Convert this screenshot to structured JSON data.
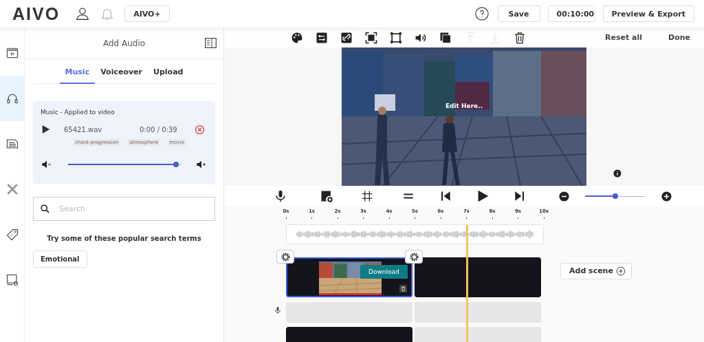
{
  "header": {
    "logo": "AIVO",
    "plan_button": "AIVO+",
    "save_button": "Save",
    "duration": "00:10:00",
    "export_button": "Preview & Export"
  },
  "rail": [
    {
      "selected": false
    },
    {
      "selected": true
    },
    {
      "selected": false
    },
    {
      "selected": false
    },
    {
      "selected": false
    },
    {
      "selected": false
    }
  ],
  "panel": {
    "title": "Add Audio",
    "tabs": [
      {
        "label": "Music",
        "selected": true
      },
      {
        "label": "Voiceover",
        "selected": false
      },
      {
        "label": "Upload",
        "selected": false
      }
    ],
    "track": {
      "heading": "Music - Applied to video",
      "file": "65421.wav",
      "time": "0:00 / 0:39",
      "tags": [
        "chord-progression",
        "atmosphere",
        "movie"
      ],
      "volume": {
        "level": 0.95
      }
    },
    "search": {
      "placeholder": "Search"
    },
    "suggestion_label": "Try some of these popular search terms",
    "suggestions": [
      "Emotional"
    ]
  },
  "toolbar": {
    "tools": [
      {
        "disabled": false
      },
      {
        "disabled": false
      },
      {
        "disabled": false
      },
      {
        "disabled": false
      },
      {
        "disabled": false
      },
      {
        "disabled": false
      },
      {
        "disabled": false
      },
      {
        "disabled": true
      },
      {
        "disabled": true
      },
      {
        "disabled": false
      }
    ],
    "reset": "Reset all",
    "done": "Done"
  },
  "preview": {
    "overlay_text": "Edit Here.."
  },
  "controls": {
    "zoom": {
      "level": 0.5
    }
  },
  "timeline": {
    "ticks": [
      "0s",
      "1s",
      "2s",
      "3s",
      "4s",
      "5s",
      "6s",
      "7s",
      "8s",
      "9s",
      "10s"
    ],
    "playhead": {
      "level": 0.7
    },
    "scenes": [
      {
        "selected": true,
        "tooltip": "Download"
      },
      {
        "selected": false
      }
    ],
    "add_scene": "Add scene"
  }
}
